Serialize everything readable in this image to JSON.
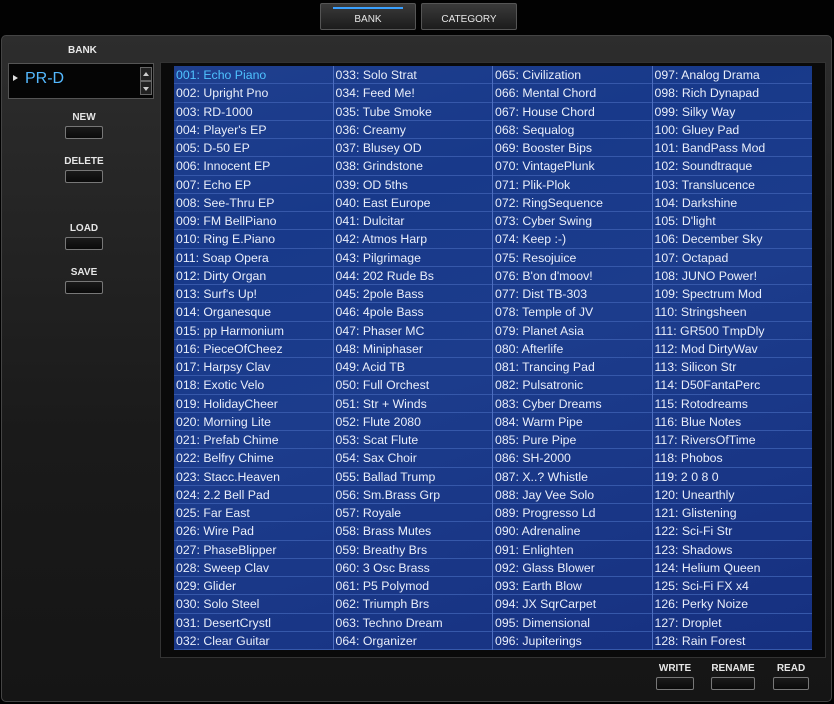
{
  "tabs": {
    "bank": "BANK",
    "category": "CATEGORY"
  },
  "bank": {
    "label": "BANK",
    "value": "PR-D"
  },
  "side_buttons": {
    "new": "NEW",
    "delete": "DELETE",
    "load": "LOAD",
    "save": "SAVE"
  },
  "bottom_buttons": {
    "write": "WRITE",
    "rename": "RENAME",
    "read": "READ"
  },
  "selected_patch": "001: Echo Piano",
  "columns": [
    [
      "001: Echo Piano",
      "002: Upright Pno",
      "003: RD-1000",
      "004: Player's EP",
      "005: D-50 EP",
      "006: Innocent EP",
      "007: Echo EP",
      "008: See-Thru EP",
      "009: FM BellPiano",
      "010: Ring E.Piano",
      "011: Soap Opera",
      "012: Dirty Organ",
      "013: Surf's Up!",
      "014: Organesque",
      "015: pp Harmonium",
      "016: PieceOfCheez",
      "017: Harpsy Clav",
      "018: Exotic Velo",
      "019: HolidayCheer",
      "020: Morning Lite",
      "021: Prefab Chime",
      "022: Belfry Chime",
      "023: Stacc.Heaven",
      "024: 2.2 Bell Pad",
      "025: Far East",
      "026: Wire Pad",
      "027: PhaseBlipper",
      "028: Sweep Clav",
      "029: Glider",
      "030: Solo Steel",
      "031: DesertCrystl",
      "032: Clear Guitar"
    ],
    [
      "033: Solo Strat",
      "034: Feed Me!",
      "035: Tube Smoke",
      "036: Creamy",
      "037: Blusey OD",
      "038: Grindstone",
      "039: OD 5ths",
      "040: East Europe",
      "041: Dulcitar",
      "042: Atmos Harp",
      "043: Pilgrimage",
      "044: 202 Rude Bs",
      "045: 2pole Bass",
      "046: 4pole Bass",
      "047: Phaser MC",
      "048: Miniphaser",
      "049: Acid TB",
      "050: Full Orchest",
      "051: Str + Winds",
      "052: Flute 2080",
      "053: Scat Flute",
      "054: Sax Choir",
      "055: Ballad Trump",
      "056: Sm.Brass Grp",
      "057: Royale",
      "058: Brass Mutes",
      "059: Breathy Brs",
      "060: 3 Osc Brass",
      "061: P5 Polymod",
      "062: Triumph Brs",
      "063: Techno Dream",
      "064: Organizer"
    ],
    [
      "065: Civilization",
      "066: Mental Chord",
      "067: House Chord",
      "068: Sequalog",
      "069: Booster Bips",
      "070: VintagePlunk",
      "071: Plik-Plok",
      "072: RingSequence",
      "073: Cyber Swing",
      "074: Keep :-)",
      "075: Resojuice",
      "076: B'on d'moov!",
      "077: Dist TB-303",
      "078: Temple of JV",
      "079: Planet Asia",
      "080: Afterlife",
      "081: Trancing Pad",
      "082: Pulsatronic",
      "083: Cyber Dreams",
      "084: Warm Pipe",
      "085: Pure Pipe",
      "086: SH-2000",
      "087: X..? Whistle",
      "088: Jay Vee Solo",
      "089: Progresso Ld",
      "090: Adrenaline",
      "091: Enlighten",
      "092: Glass Blower",
      "093: Earth Blow",
      "094: JX SqrCarpet",
      "095: Dimensional",
      "096: Jupiterings"
    ],
    [
      "097: Analog Drama",
      "098: Rich Dynapad",
      "099: Silky Way",
      "100: Gluey Pad",
      "101: BandPass Mod",
      "102: Soundtraque",
      "103: Translucence",
      "104: Darkshine",
      "105: D'light",
      "106: December Sky",
      "107: Octapad",
      "108: JUNO Power!",
      "109: Spectrum Mod",
      "110: Stringsheen",
      "111: GR500 TmpDly",
      "112: Mod DirtyWav",
      "113: Silicon Str",
      "114: D50FantaPerc",
      "115: Rotodreams",
      "116: Blue Notes",
      "117: RiversOfTime",
      "118: Phobos",
      "119: 2 0 8 0",
      "120: Unearthly",
      "121: Glistening",
      "122: Sci-Fi Str",
      "123: Shadows",
      "124: Helium Queen",
      "125: Sci-Fi FX x4",
      "126: Perky Noize",
      "127: Droplet",
      "128: Rain Forest"
    ]
  ]
}
